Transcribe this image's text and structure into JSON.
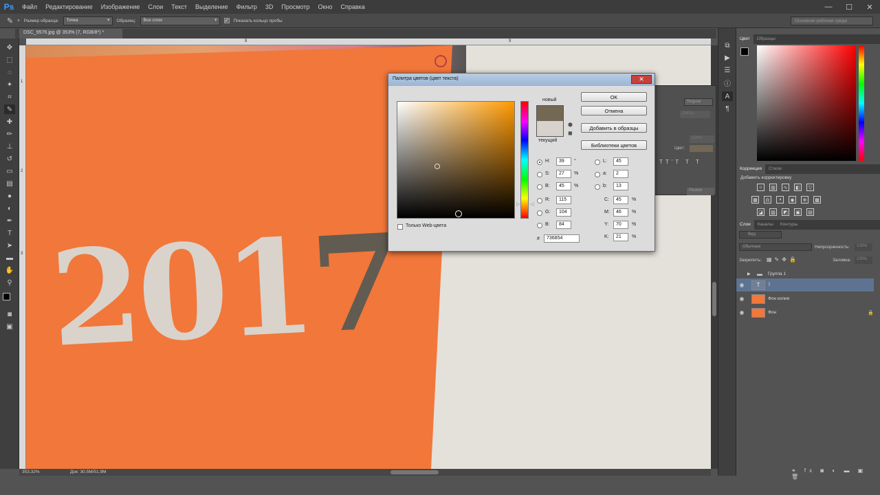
{
  "app": {
    "logo": "Ps"
  },
  "menu": [
    "Файл",
    "Редактирование",
    "Изображение",
    "Слои",
    "Текст",
    "Выделение",
    "Фильтр",
    "3D",
    "Просмотр",
    "Окно",
    "Справка"
  ],
  "window_controls": {
    "minimize": "—",
    "maximize": "☐",
    "close": "✕"
  },
  "options": {
    "sample_size_label": "Размер образца:",
    "sample_size_value": "Точка",
    "sample_label": "Образец:",
    "sample_value": "Все слои",
    "show_ring_label": "Показать кольцо пробы",
    "show_ring_checked": true,
    "workspace": "Основная рабочая среда"
  },
  "document": {
    "tab_title": "DSC_9576.jpg @ 353% (7, RGB/8*) *",
    "canvas_text": "2017",
    "canvas_text_main": "201",
    "canvas_text_last": "7"
  },
  "ruler": {
    "top_marks": [
      "8",
      "9"
    ],
    "left_marks": [
      "1",
      "2",
      "3"
    ]
  },
  "status": {
    "zoom": "353,32%",
    "doc_size": "Док: 30,5M/51,9M"
  },
  "dialog": {
    "title": "Палитра цветов (цвет текста)",
    "close": "✕",
    "new_label": "новый",
    "current_label": "текущий",
    "new_color": "#736854",
    "current_color": "#d8d2cc",
    "buttons": {
      "ok": "OK",
      "cancel": "Отмена",
      "add_swatch": "Добавить в образцы",
      "libraries": "Библиотеки цветов"
    },
    "fields": {
      "H": {
        "label": "H:",
        "value": "39",
        "unit": "°"
      },
      "S": {
        "label": "S:",
        "value": "27",
        "unit": "%"
      },
      "B": {
        "label": "B:",
        "value": "45",
        "unit": "%"
      },
      "R": {
        "label": "R:",
        "value": "115"
      },
      "G": {
        "label": "G:",
        "value": "104"
      },
      "Bl": {
        "label": "B:",
        "value": "84"
      },
      "L": {
        "label": "L:",
        "value": "45"
      },
      "a": {
        "label": "a:",
        "value": "2"
      },
      "b": {
        "label": "b:",
        "value": "13"
      },
      "C": {
        "label": "C:",
        "value": "45",
        "unit": "%"
      },
      "M": {
        "label": "M:",
        "value": "46",
        "unit": "%"
      },
      "Y": {
        "label": "Y:",
        "value": "70",
        "unit": "%"
      },
      "K": {
        "label": "K:",
        "value": "21",
        "unit": "%"
      },
      "hex_label": "#",
      "hex": "736854"
    },
    "web_only": "Только Web-цвета"
  },
  "panels": {
    "color_tabs": [
      "Цвет",
      "Образцы"
    ],
    "adjust_tabs": [
      "Коррекция",
      "Стили"
    ],
    "adjust_title": "Добавить корректировку",
    "layer_tabs": [
      "Слои",
      "Каналы",
      "Контуры"
    ],
    "kind": "Вид",
    "blend": "Обычные",
    "opacity_label": "Непрозрачность:",
    "opacity": "100%",
    "lock_label": "Закрепить:",
    "fill_label": "Заливка:",
    "fill": "100%",
    "layers": [
      {
        "name": "Группа 1",
        "type": "group"
      },
      {
        "name": "7",
        "type": "text",
        "selected": true
      },
      {
        "name": "Фон копия",
        "type": "image"
      },
      {
        "name": "Фон",
        "type": "image",
        "locked": true
      }
    ]
  },
  "char_panel": {
    "font_style": "Regular",
    "auto": "(Авто)",
    "scale": "100%",
    "color_label": "Цвет:",
    "sharp": "Резкое"
  },
  "colors": {
    "accent": "#3aa0ff",
    "orange": "#f2773a",
    "text_color": "#736854"
  }
}
